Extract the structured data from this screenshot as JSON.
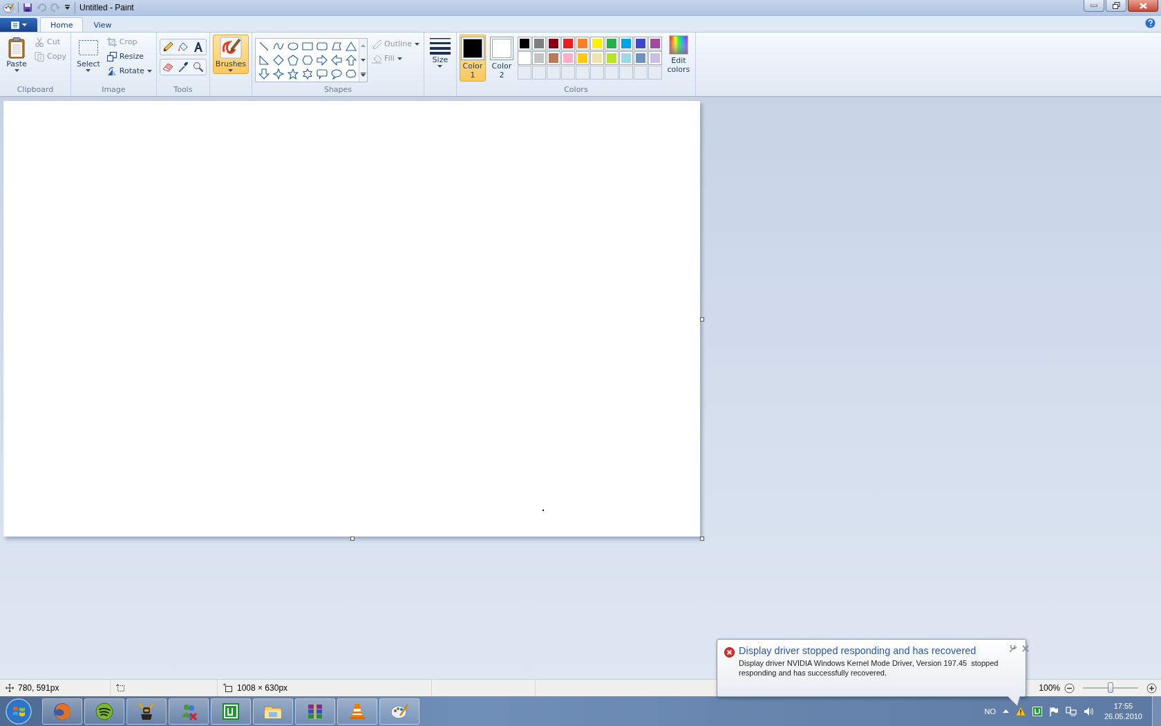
{
  "window": {
    "title": "Untitled - Paint"
  },
  "tabs": [
    {
      "label": "Home",
      "selected": true
    },
    {
      "label": "View",
      "selected": false
    }
  ],
  "clipboard": {
    "label": "Clipboard",
    "paste": "Paste",
    "commands": [
      {
        "label": "Cut",
        "disabled": true
      },
      {
        "label": "Copy",
        "disabled": true
      }
    ]
  },
  "image": {
    "label": "Image",
    "select": "Select",
    "commands": [
      {
        "label": "Crop",
        "disabled": true
      },
      {
        "label": "Resize",
        "disabled": false
      },
      {
        "label": "Rotate",
        "disabled": false
      }
    ]
  },
  "tools": {
    "label": "Tools"
  },
  "brushes": {
    "label": "Brushes",
    "selected": true
  },
  "shapes": {
    "label": "Shapes",
    "options": [
      {
        "label": "Outline",
        "disabled": true
      },
      {
        "label": "Fill",
        "disabled": true
      }
    ]
  },
  "size": {
    "label": "Size"
  },
  "colors": {
    "label": "Colors",
    "edit": "Edit colors",
    "active": [
      {
        "label": "Color 1",
        "color": "#000000",
        "selected": true
      },
      {
        "label": "Color 2",
        "color": "#ffffff",
        "selected": false
      }
    ],
    "palette": [
      {
        "kind": "swatch",
        "color": "#000000"
      },
      {
        "kind": "swatch",
        "color": "#7f7f7f"
      },
      {
        "kind": "swatch",
        "color": "#880015"
      },
      {
        "kind": "swatch",
        "color": "#ed1c24"
      },
      {
        "kind": "swatch",
        "color": "#ff7f27"
      },
      {
        "kind": "swatch",
        "color": "#fff200"
      },
      {
        "kind": "swatch",
        "color": "#22b14c"
      },
      {
        "kind": "swatch",
        "color": "#00a2e8"
      },
      {
        "kind": "swatch",
        "color": "#3f48cc"
      },
      {
        "kind": "swatch",
        "color": "#a349a4"
      },
      {
        "kind": "swatch",
        "color": "#ffffff"
      },
      {
        "kind": "swatch",
        "color": "#c3c3c3"
      },
      {
        "kind": "swatch",
        "color": "#b97a57"
      },
      {
        "kind": "swatch",
        "color": "#ffaec9"
      },
      {
        "kind": "swatch",
        "color": "#ffc90e"
      },
      {
        "kind": "swatch",
        "color": "#efe4b0"
      },
      {
        "kind": "swatch",
        "color": "#b5e61d"
      },
      {
        "kind": "swatch",
        "color": "#99d9ea"
      },
      {
        "kind": "swatch",
        "color": "#7092be"
      },
      {
        "kind": "swatch",
        "color": "#c8bfe7"
      },
      {
        "kind": "empty"
      },
      {
        "kind": "empty"
      },
      {
        "kind": "empty"
      },
      {
        "kind": "empty"
      },
      {
        "kind": "empty"
      },
      {
        "kind": "empty"
      },
      {
        "kind": "empty"
      },
      {
        "kind": "empty"
      },
      {
        "kind": "empty"
      },
      {
        "kind": "empty"
      }
    ]
  },
  "status_bar": {
    "cursor": "780, 591px",
    "size": "1008 × 630px",
    "zoom": "100%",
    "zoom_slider": {
      "level": 0.5
    }
  },
  "notification": {
    "title": "Display driver stopped responding and has recovered",
    "message": "Display driver NVIDIA Windows Kernel Mode Driver, Version 197.45  stopped responding and has successfully recovered."
  },
  "tray": {
    "language": "NO",
    "time": "17:55",
    "date": "26.05.2010"
  }
}
